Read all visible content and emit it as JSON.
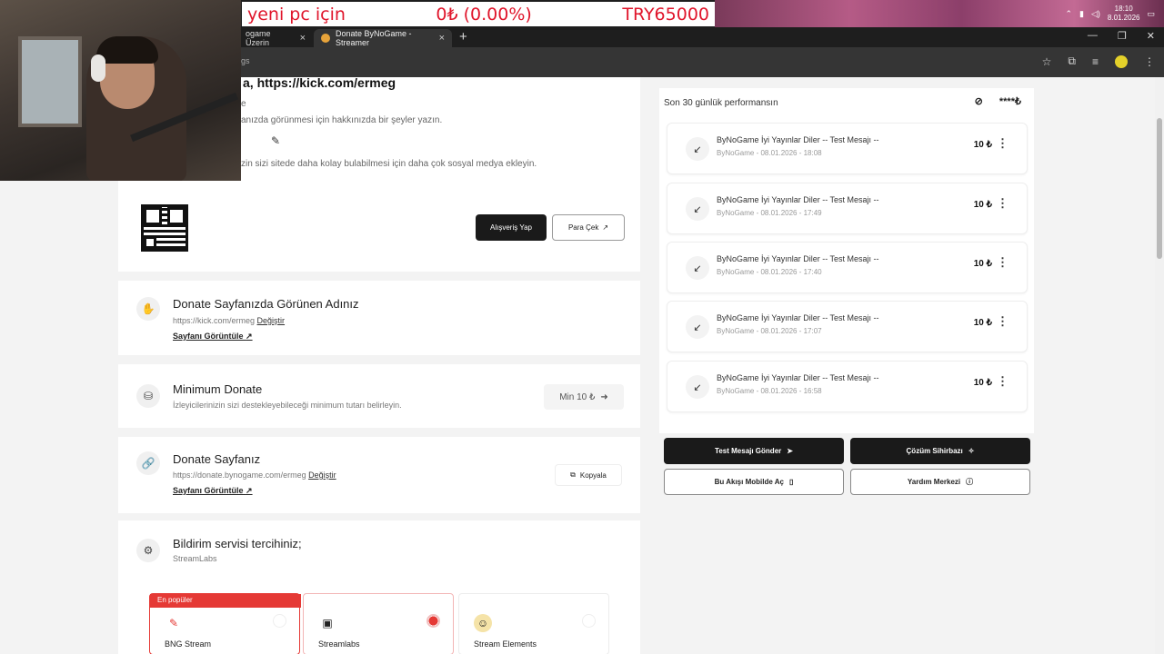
{
  "ticker": {
    "left": "yeni pc için",
    "middle": "0₺ (0.00%)",
    "right": "TRY65000"
  },
  "tray": {
    "time": "18:10",
    "date": "8.01.2026"
  },
  "tabs": [
    {
      "label": "ogame Üzerin"
    },
    {
      "label": "Donate ByNoGame - Streamer"
    }
  ],
  "address": {
    "url": "gs"
  },
  "profile": {
    "name_prefix": "a,",
    "name": "https://kick.com/ermeg",
    "line1": "e",
    "line2": "anızda görünmesi için hakkınızda bir şeyler yazın.",
    "line3": "zin sizi sitede daha kolay bulabilmesi için daha çok sosyal medya ekleyin."
  },
  "qr_actions": {
    "shop": "Alışveriş Yap",
    "withdraw": "Para Çek"
  },
  "settings": {
    "display_name": {
      "title": "Donate Sayfanızda Görünen Adınız",
      "value": "https://kick.com/ermeg",
      "change": "Değiştir",
      "view": "Sayfanı Görüntüle"
    },
    "minimum": {
      "title": "Minimum Donate",
      "desc": "İzleyicilerinizin sizi destekleyebileceği minimum tutarı belirleyin.",
      "value": "Min 10 ₺"
    },
    "donate_page": {
      "title": "Donate Sayfanız",
      "value": "https://donate.bynogame.com/ermeg",
      "change": "Değiştir",
      "view": "Sayfanı Görüntüle",
      "copy": "Kopyala"
    },
    "notify": {
      "title": "Bildirim servisi tercihiniz;",
      "value": "StreamLabs"
    }
  },
  "providers": [
    {
      "name": "BNG Stream",
      "badge": "En popüler",
      "selected": false
    },
    {
      "name": "Streamlabs",
      "badge": "",
      "selected": true
    },
    {
      "name": "Stream Elements",
      "badge": "",
      "selected": false
    }
  ],
  "performance": {
    "title": "Son 30 günlük performansın",
    "hidden_value": "****₺",
    "transactions": [
      {
        "message": "ByNoGame İyi Yayınlar Diler -- Test Mesajı --",
        "meta": "ByNoGame - 08.01.2026 - 18:08",
        "amount": "10 ₺"
      },
      {
        "message": "ByNoGame İyi Yayınlar Diler -- Test Mesajı --",
        "meta": "ByNoGame - 08.01.2026 - 17:49",
        "amount": "10 ₺"
      },
      {
        "message": "ByNoGame İyi Yayınlar Diler -- Test Mesajı --",
        "meta": "ByNoGame - 08.01.2026 - 17:40",
        "amount": "10 ₺"
      },
      {
        "message": "ByNoGame İyi Yayınlar Diler -- Test Mesajı --",
        "meta": "ByNoGame - 08.01.2026 - 17:07",
        "amount": "10 ₺"
      },
      {
        "message": "ByNoGame İyi Yayınlar Diler -- Test Mesajı --",
        "meta": "ByNoGame - 08.01.2026 - 16:58",
        "amount": "10 ₺"
      }
    ]
  },
  "actions": {
    "test": "Test Mesajı Gönder",
    "wizard": "Çözüm Sihirbazı",
    "mobile": "Bu Akışı Mobilde Aç",
    "help": "Yardım Merkezi"
  }
}
